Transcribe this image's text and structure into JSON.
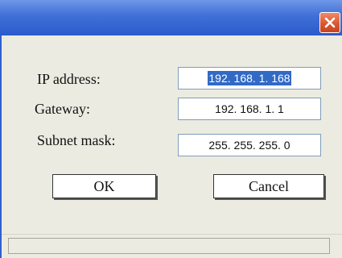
{
  "window": {
    "close_icon": "close-x-icon"
  },
  "fields": {
    "ip_address": {
      "label": "IP address:",
      "value": "192. 168. 1. 168"
    },
    "gateway": {
      "label": "Gateway:",
      "value": "192. 168. 1. 1"
    },
    "subnet_mask": {
      "label": "Subnet mask:",
      "value": "255. 255. 255. 0"
    }
  },
  "buttons": {
    "ok": "OK",
    "cancel": "Cancel"
  },
  "statusbar": {
    "text": ""
  },
  "colors": {
    "titlebar": "#2a5bcc",
    "close_button": "#d8552e",
    "dialog_background": "#ecebe1",
    "selection": "#316ac5"
  }
}
